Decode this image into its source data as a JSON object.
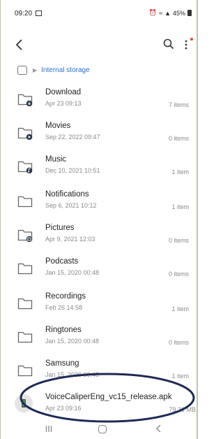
{
  "status_bar": {
    "time": "09:20",
    "battery": "45%"
  },
  "breadcrumb": {
    "label": "Internal storage"
  },
  "items": [
    {
      "name": "Download",
      "date": "Apr 23 09:13",
      "count": "7 items",
      "icon": "folder-download-icon"
    },
    {
      "name": "Movies",
      "date": "Sep 22, 2022 09:47",
      "count": "0 items",
      "icon": "folder-movies-icon"
    },
    {
      "name": "Music",
      "date": "Dec 10, 2021 10:51",
      "count": "1 item",
      "icon": "folder-music-icon"
    },
    {
      "name": "Notifications",
      "date": "Sep 6, 2021 10:12",
      "count": "1 item",
      "icon": "folder-icon"
    },
    {
      "name": "Pictures",
      "date": "Apr 9, 2021 12:03",
      "count": "0 items",
      "icon": "folder-pictures-icon"
    },
    {
      "name": "Podcasts",
      "date": "Jan 15, 2020 00:48",
      "count": "0 items",
      "icon": "folder-icon"
    },
    {
      "name": "Recordings",
      "date": "Feb 26 14:58",
      "count": "1 item",
      "icon": "folder-icon"
    },
    {
      "name": "Ringtones",
      "date": "Jan 15, 2020 00:48",
      "count": "0 items",
      "icon": "folder-icon"
    },
    {
      "name": "Samsung",
      "date": "Jan 15, 2020 00:48",
      "count": "1 item",
      "icon": "folder-icon"
    },
    {
      "name": "VoiceCaliperEng_vc15_release.apk",
      "date": "Apr 23 09:16",
      "count": "79.31 MB",
      "icon": "apk-file-icon"
    }
  ],
  "colors": {
    "accent": "#2a6fd0",
    "annotation": "#1e2a55",
    "notification_dot": "#e4502b"
  }
}
